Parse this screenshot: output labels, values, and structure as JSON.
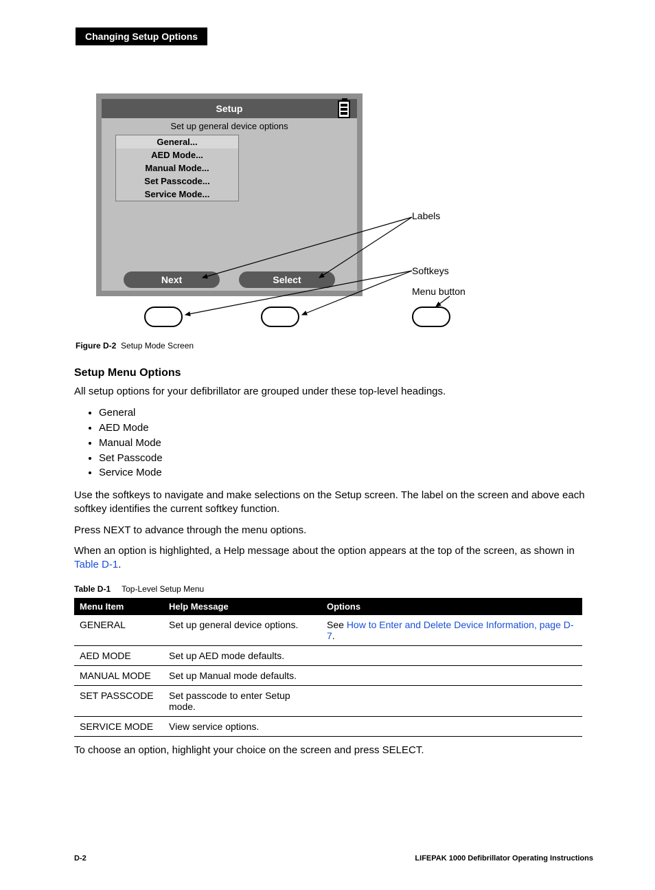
{
  "header": {
    "tag": "Changing Setup Options"
  },
  "device": {
    "title": "Setup",
    "subtitle": "Set up general device options",
    "menu": [
      "General...",
      "AED Mode...",
      "Manual Mode...",
      "Set Passcode...",
      "Service Mode..."
    ],
    "softkeys": {
      "left": "Next",
      "right": "Select"
    }
  },
  "annotations": {
    "labels": "Labels",
    "softkeys": "Softkeys",
    "menu_button": "Menu button"
  },
  "figure": {
    "id": "Figure D-2",
    "caption": "Setup Mode Screen"
  },
  "section_heading": "Setup Menu Options",
  "intro": "All setup options for your defibrillator are grouped under these top-level headings.",
  "bullets": [
    "General",
    "AED Mode",
    "Manual Mode",
    "Set Passcode",
    "Service Mode"
  ],
  "para_softkeys": "Use the softkeys to navigate and make selections on the Setup screen. The label on the screen and above each softkey identifies the current softkey function.",
  "para_next": "Press NEXT to advance through the menu options.",
  "para_help_prefix": "When an option is highlighted, a Help message about the option appears at the top of the screen, as shown in ",
  "para_help_link": "Table D-1",
  "para_help_suffix": ".",
  "table": {
    "id": "Table D-1",
    "caption": "Top-Level Setup Menu",
    "headers": [
      "Menu Item",
      "Help Message",
      "Options"
    ],
    "rows": [
      {
        "item": "GENERAL",
        "help": "Set up general device options.",
        "opt_prefix": "See ",
        "opt_link": "How to Enter and Delete Device Information, page D-7",
        "opt_suffix": "."
      },
      {
        "item": "AED MODE",
        "help": "Set up AED mode defaults.",
        "opt_prefix": "",
        "opt_link": "",
        "opt_suffix": ""
      },
      {
        "item": "MANUAL MODE",
        "help": "Set up Manual mode defaults.",
        "opt_prefix": "",
        "opt_link": "",
        "opt_suffix": ""
      },
      {
        "item": "SET PASSCODE",
        "help": "Set passcode to enter Setup mode.",
        "opt_prefix": "",
        "opt_link": "",
        "opt_suffix": ""
      },
      {
        "item": "SERVICE MODE",
        "help": "View service options.",
        "opt_prefix": "",
        "opt_link": "",
        "opt_suffix": ""
      }
    ]
  },
  "closing": "To choose an option, highlight your choice on the screen and press SELECT.",
  "footer": {
    "page": "D-2",
    "doc": "LIFEPAK 1000 Defibrillator Operating Instructions"
  }
}
